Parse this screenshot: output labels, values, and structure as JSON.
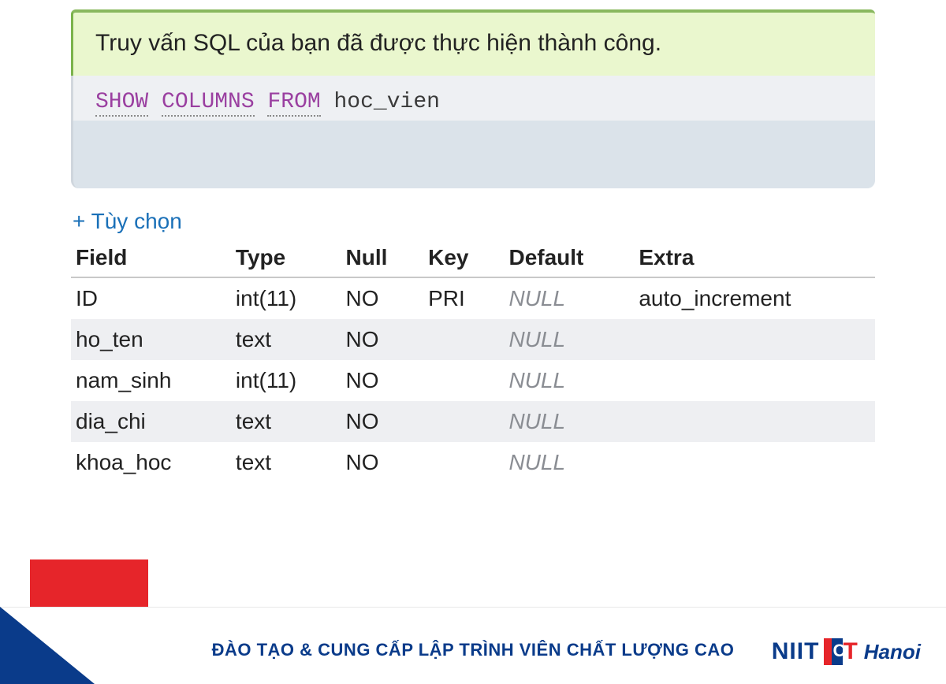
{
  "status_message": "Truy vấn SQL của bạn đã được thực hiện thành công.",
  "sql": {
    "kw_show": "SHOW",
    "kw_columns": "COLUMNS",
    "kw_from": "FROM",
    "target": "hoc_vien"
  },
  "options_label": "+ Tùy chọn",
  "table": {
    "headers": [
      "Field",
      "Type",
      "Null",
      "Key",
      "Default",
      "Extra"
    ],
    "rows": [
      {
        "field": "ID",
        "type": "int(11)",
        "null": "NO",
        "key": "PRI",
        "default": "NULL",
        "extra": "auto_increment"
      },
      {
        "field": "ho_ten",
        "type": "text",
        "null": "NO",
        "key": "",
        "default": "NULL",
        "extra": ""
      },
      {
        "field": "nam_sinh",
        "type": "int(11)",
        "null": "NO",
        "key": "",
        "default": "NULL",
        "extra": ""
      },
      {
        "field": "dia_chi",
        "type": "text",
        "null": "NO",
        "key": "",
        "default": "NULL",
        "extra": ""
      },
      {
        "field": "khoa_hoc",
        "type": "text",
        "null": "NO",
        "key": "",
        "default": "NULL",
        "extra": ""
      }
    ]
  },
  "footer": {
    "tagline": "ĐÀO TẠO & CUNG CẤP LẬP TRÌNH VIÊN CHẤT LƯỢNG CAO",
    "brand_niit": "NIIT",
    "brand_hanoi": "Hanoi"
  }
}
